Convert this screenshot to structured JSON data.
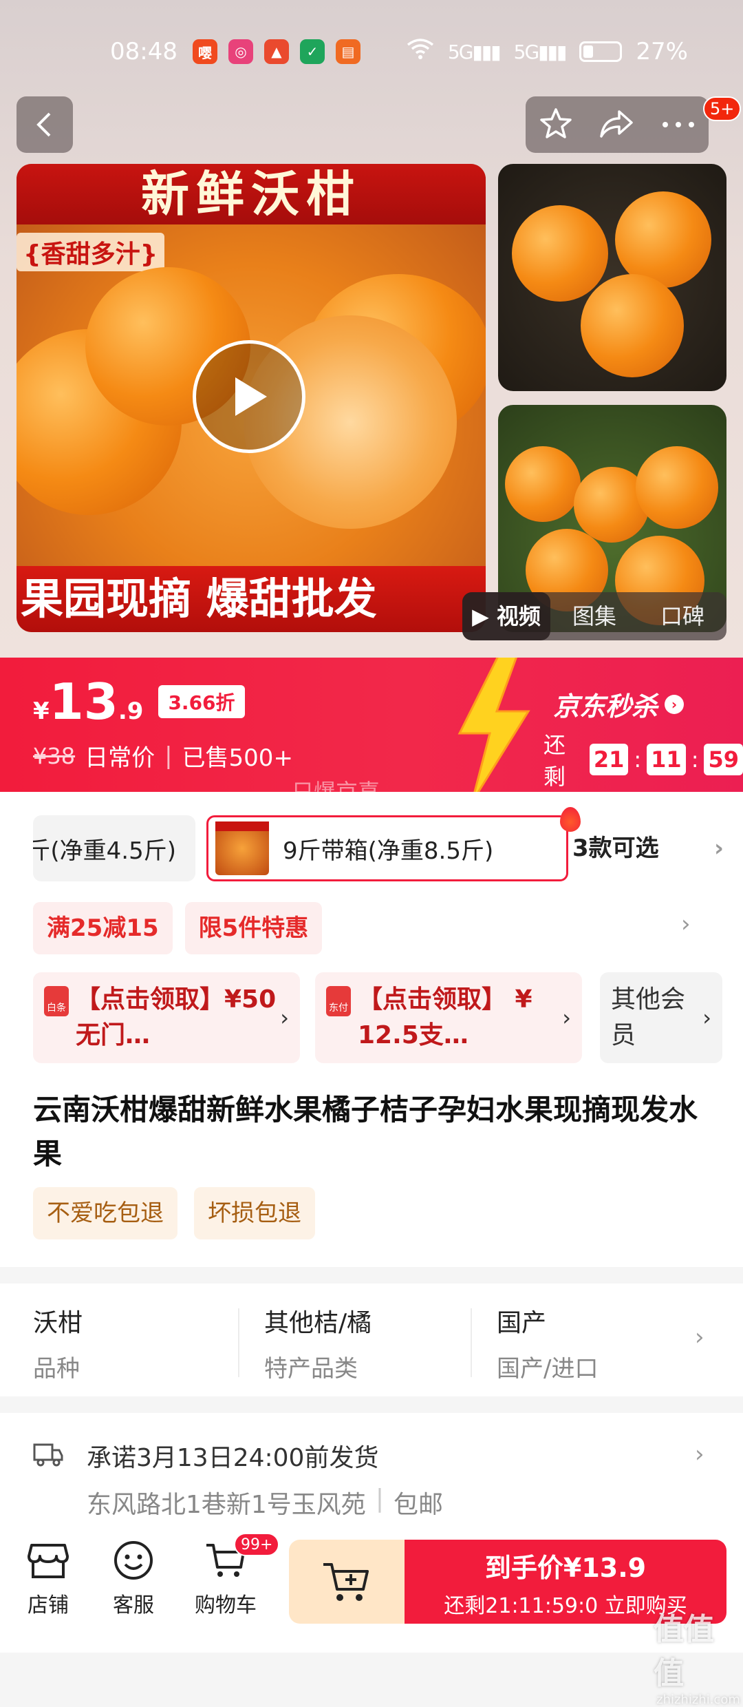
{
  "status_bar": {
    "time": "08:48",
    "network": "5G",
    "battery": "27%",
    "app_icons": [
      "app-icon-1",
      "app-icon-2",
      "app-icon-3",
      "app-icon-4",
      "app-icon-5"
    ]
  },
  "header": {
    "notification_badge": "5+"
  },
  "gallery": {
    "main_banner_top": "新鲜沃柑",
    "main_tagline": "{香甜多汁}",
    "main_banner_bottom": "果园现摘 爆甜批发",
    "tabs": [
      {
        "label": "视频",
        "active": true
      },
      {
        "label": "图集",
        "active": false
      },
      {
        "label": "口碑",
        "active": false
      }
    ]
  },
  "price": {
    "symbol": "¥",
    "integer": "13",
    "decimal": ".9",
    "discount": "3.66折",
    "original": "¥38",
    "original_label": "日常价",
    "sold": "已售500+",
    "seckill_title": "京东秒杀",
    "remaining_label": "还剩",
    "countdown": [
      "21",
      "11",
      "59"
    ],
    "ghost_text": "只爆京喜"
  },
  "variants": {
    "option_partial": "斤(净重4.5斤)",
    "option_selected": "9斤带箱(净重8.5斤)",
    "more_label": "3款可选"
  },
  "promos": [
    "满25减15",
    "限5件特惠"
  ],
  "coupons": [
    {
      "text": "【点击领取】¥50无门…",
      "icon_label": "白条"
    },
    {
      "text": "【点击领取】 ¥ 12.5支…",
      "icon_label": "东付"
    },
    {
      "text": "其他会员"
    }
  ],
  "product": {
    "title": "云南沃柑爆甜新鲜水果橘子桔子孕妇水果现摘现发水果",
    "guarantees": [
      "不爱吃包退",
      "坏损包退"
    ]
  },
  "attributes": [
    {
      "value": "沃柑",
      "key": "品种"
    },
    {
      "value": "其他桔/橘",
      "key": "特产品类"
    },
    {
      "value": "国产",
      "key": "国产/进口"
    }
  ],
  "shipping": {
    "promise": "承诺3月13日24:00前发货",
    "address": "东风路北1巷新1号玉风苑",
    "free_shipping": "包邮"
  },
  "bottom_bar": {
    "store": "店铺",
    "service": "客服",
    "cart": "购物车",
    "cart_badge": "99+",
    "buy_line1": "到手价¥13.9",
    "buy_line2": "还剩21:11:59:0 立即购买"
  },
  "watermark": {
    "main": "值值值",
    "sub": "zhizhizhi.com"
  },
  "colors": {
    "accent": "#f21c3c",
    "coupon_bg": "#fdf0f0",
    "guarantee_text": "#a65e12"
  }
}
